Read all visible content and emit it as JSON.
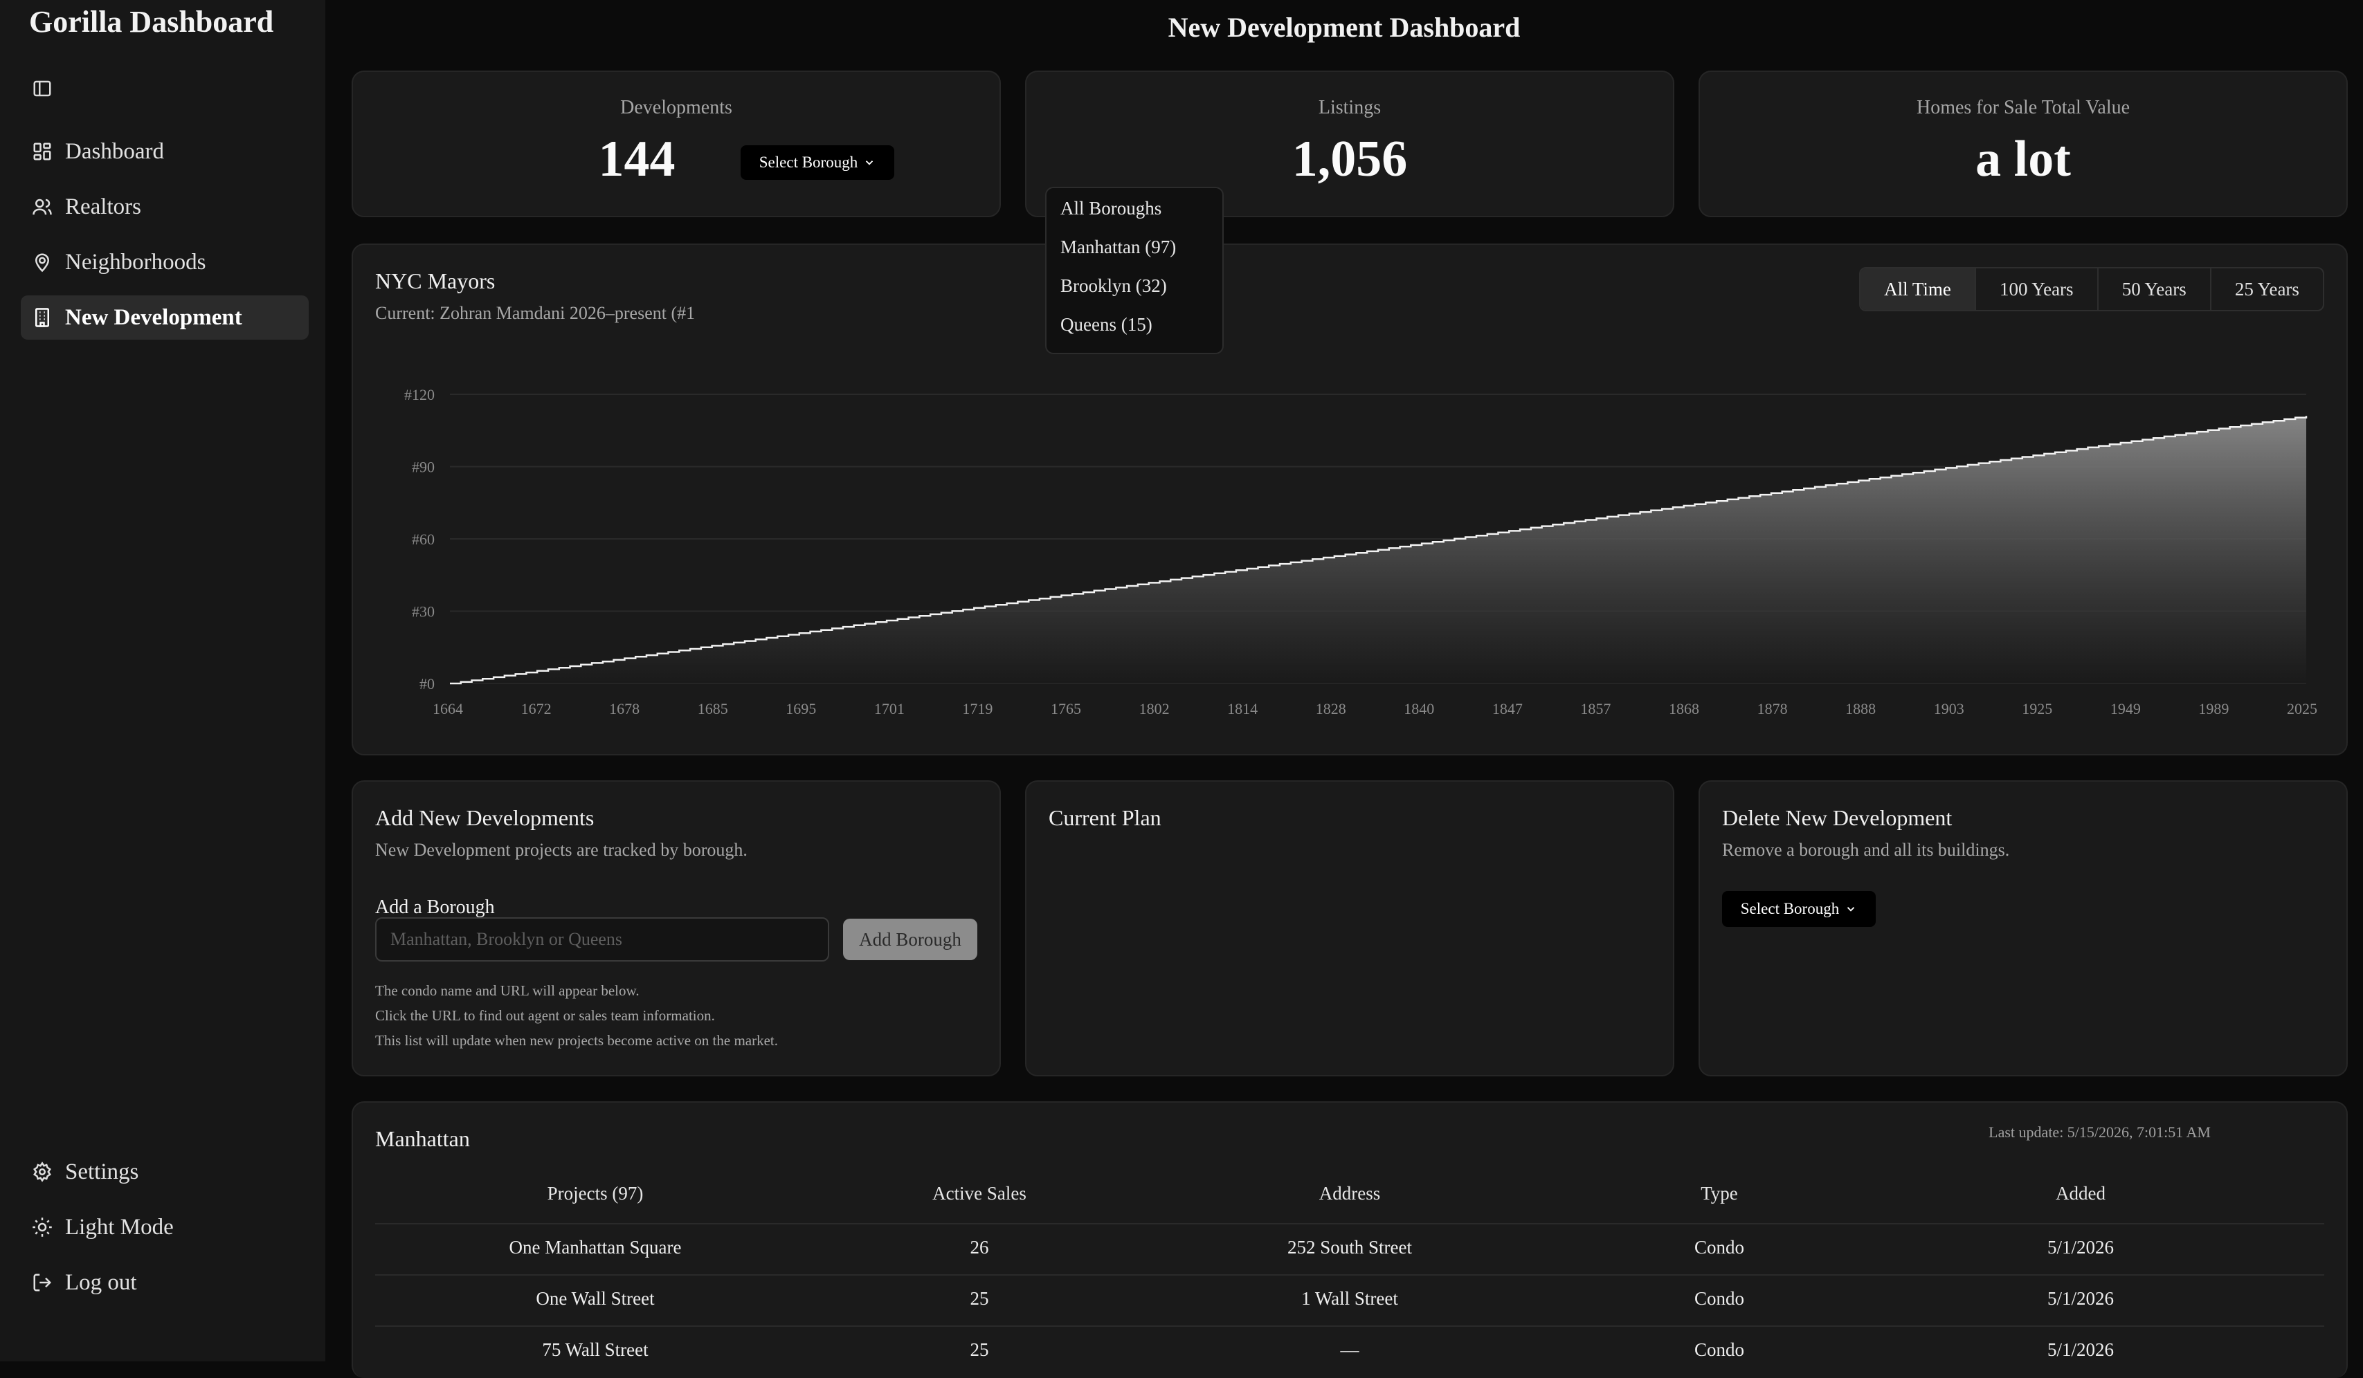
{
  "sidebar": {
    "brand": "Gorilla Dashboard",
    "nav": [
      {
        "label": "Dashboard",
        "icon": "grid-icon"
      },
      {
        "label": "Realtors",
        "icon": "users-icon"
      },
      {
        "label": "Neighborhoods",
        "icon": "map-pin-icon"
      },
      {
        "label": "New Development",
        "icon": "building-icon",
        "active": true
      }
    ],
    "bottom": [
      {
        "label": "Settings",
        "icon": "gear-icon"
      },
      {
        "label": "Light Mode",
        "icon": "sun-icon"
      },
      {
        "label": "Log out",
        "icon": "logout-icon"
      }
    ]
  },
  "header": {
    "title": "New Development Dashboard"
  },
  "stats": {
    "developments": {
      "label": "Developments",
      "value": "144",
      "select_label": "Select Borough"
    },
    "listings": {
      "label": "Listings",
      "value": "1,056"
    },
    "homes_value": {
      "label": "Homes for Sale Total Value",
      "value": "a lot"
    }
  },
  "borough_dropdown": {
    "options": [
      "All Boroughs",
      "Manhattan (97)",
      "Brooklyn (32)",
      "Queens (15)"
    ]
  },
  "mayors": {
    "title": "NYC Mayors",
    "subtitle": "Current: Zohran Mamdani 2026–present (#1",
    "ranges": [
      "All Time",
      "100 Years",
      "50 Years",
      "25 Years"
    ],
    "selected_range": "All Time"
  },
  "chart_data": {
    "type": "area",
    "title": "NYC Mayors",
    "xlabel": "",
    "ylabel": "",
    "x": [
      "1664",
      "1672",
      "1678",
      "1685",
      "1695",
      "1701",
      "1719",
      "1765",
      "1802",
      "1814",
      "1828",
      "1840",
      "1847",
      "1857",
      "1868",
      "1878",
      "1888",
      "1903",
      "1925",
      "1949",
      "1989",
      "2025"
    ],
    "y_ticks": [
      "#0",
      "#30",
      "#60",
      "#90",
      "#120"
    ],
    "ylim": [
      0,
      120
    ],
    "y_start": 0,
    "y_end": 111,
    "grid": true,
    "colors": {
      "fill_top": "#8a8a8a",
      "fill_bottom": "#1a1a1a",
      "line": "#f2f2f2",
      "grid": "#2a2a2a"
    }
  },
  "add_dev": {
    "title": "Add New Developments",
    "subtitle": "New Development projects are tracked by borough.",
    "field_label": "Add a Borough",
    "placeholder": "Manhattan, Brooklyn or Queens",
    "button": "Add Borough",
    "notes": [
      "The condo name and URL will appear below.",
      "Click the URL to find out agent or sales team information.",
      "This list will update when new projects become active on the market."
    ]
  },
  "current_plan": {
    "title": "Current Plan"
  },
  "delete_dev": {
    "title": "Delete New Development",
    "subtitle": "Remove a borough and all its buildings.",
    "select_label": "Select Borough"
  },
  "table": {
    "title": "Manhattan",
    "last_update": "Last update: 5/15/2026, 7:01:51 AM",
    "columns": [
      "Projects (97)",
      "Active Sales",
      "Address",
      "Type",
      "Added"
    ],
    "rows": [
      [
        "One Manhattan Square",
        "26",
        "252 South Street",
        "Condo",
        "5/1/2026"
      ],
      [
        "One Wall Street",
        "25",
        "1 Wall Street",
        "Condo",
        "5/1/2026"
      ],
      [
        "75 Wall Street",
        "25",
        "—",
        "Condo",
        "5/1/2026"
      ]
    ]
  }
}
